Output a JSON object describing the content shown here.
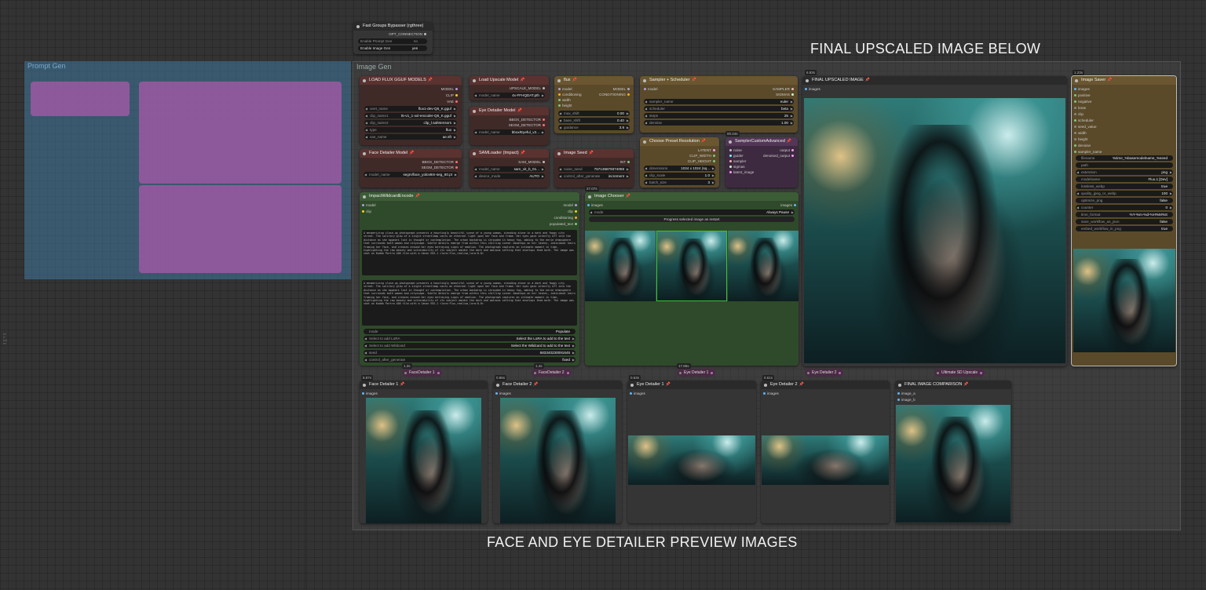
{
  "colors": {
    "canvas": "#333333",
    "group_blue": "#3f789e",
    "group_purple": "#a050a0",
    "node_dark": "#353535",
    "node_brown": "#3f2a28",
    "node_gold": "#5a4a2a",
    "node_green": "#2f4a2a",
    "node_purple": "#3e2a40"
  },
  "annotations": {
    "top_label": "FINAL UPSCALED IMAGE BELOW",
    "bottom_label": "FACE AND EYE DETAILER PREVIEW IMAGES"
  },
  "bypasser": {
    "title": "Fast Groups Bypasser (rgthree)",
    "output": "OPT_CONNECTION",
    "rows": [
      {
        "label": "Enable Prompt Gen",
        "state": "no"
      },
      {
        "label": "Enable Image Gen",
        "state": "yes"
      }
    ]
  },
  "groups": {
    "image_gen": "Image Gen",
    "prompt_gen": "Prompt Gen"
  },
  "flux_models": {
    "title": "LOAD FLUX GGUF MODELS",
    "outputs": [
      "MODEL",
      "CLIP",
      "VAE"
    ],
    "widgets": [
      {
        "label": "unet_name",
        "value": "flux1-dev-Q6_K.gguf"
      },
      {
        "label": "clip_name1",
        "value": "t5-v1_1-xxl-encoder-Q6_K.gguf"
      },
      {
        "label": "clip_name2",
        "value": "clip_l.safetensors"
      },
      {
        "label": "type",
        "value": "flux"
      },
      {
        "label": "vae_name",
        "value": "ae.sft"
      }
    ]
  },
  "upscale_model": {
    "title": "Load Upscale Model",
    "output": "UPSCALE_MODEL",
    "widget": {
      "label": "model_name",
      "value": "4x-FFHQDAT.pth"
    }
  },
  "eye_detailer_model": {
    "title": "Eye Detailer Model",
    "outputs": [
      "BBOX_DETECTOR",
      "SEGM_DETECTOR"
    ],
    "widget": {
      "label": "model_name",
      "value": "bbox/Eyeful_v2..."
    }
  },
  "flux_node": {
    "title": "flux",
    "inputs": [
      "model",
      "conditioning",
      "width",
      "height"
    ],
    "outputs": [
      "MODEL",
      "CONDITIONING"
    ],
    "widgets": [
      {
        "label": "max_shift",
        "value": "0.00"
      },
      {
        "label": "base_shift",
        "value": "0.40"
      },
      {
        "label": "guidance",
        "value": "3.8"
      }
    ]
  },
  "sampler": {
    "title": "Sampler + Scheduler",
    "inputs": [
      "model"
    ],
    "outputs": [
      "SAMPLER",
      "SIGMAS"
    ],
    "widgets": [
      {
        "label": "sampler_name",
        "value": "euler"
      },
      {
        "label": "scheduler",
        "value": "beta"
      },
      {
        "label": "steps",
        "value": "25"
      },
      {
        "label": "denoise",
        "value": "1.00"
      }
    ]
  },
  "face_detailer_model": {
    "title": "Face Detailer Model",
    "outputs": [
      "BBOX_DETECTOR",
      "SEGM_DETECTOR"
    ],
    "widget": {
      "label": "model_name",
      "value": "segm/face_yolov8m-seg_60.pt"
    }
  },
  "sam_loader": {
    "title": "SAMLoader (Impact)",
    "output": "SAM_MODEL",
    "widgets": [
      {
        "label": "model_name",
        "value": "sam_vit_b_01..."
      },
      {
        "label": "device_mode",
        "value": "AUTO"
      }
    ]
  },
  "image_seed": {
    "title": "Image Seed",
    "output": "INT",
    "widgets": [
      {
        "label": "noise_seed",
        "value": "757135879374059"
      },
      {
        "label": "control_after_generate",
        "value": "increment"
      }
    ]
  },
  "preset_res": {
    "title": "Choose Preset Resolution",
    "badge": "00.24s",
    "outputs": [
      "LATENT",
      "CLIP_WIDTH",
      "CLIP_HEIGHT"
    ],
    "widgets": [
      {
        "label": "dimensions",
        "value": "1024 x 1024 (sq..."
      },
      {
        "label": "clip_scale",
        "value": "1.0"
      },
      {
        "label": "batch_size",
        "value": "3"
      }
    ]
  },
  "sampler_custom": {
    "title": "SamplerCustomAdvanced",
    "inputs": [
      "noise",
      "guider",
      "sampler",
      "sigmas",
      "latent_image"
    ],
    "outputs": [
      "output",
      "denoised_output"
    ]
  },
  "wildcard": {
    "title": "ImpactWildcardEncode",
    "inputs": [
      "model",
      "clip"
    ],
    "outputs": [
      "model",
      "clip",
      "conditioning",
      "populated_text"
    ],
    "prompt_text": "A mesmerizing close-up photograph presents a hauntingly beautiful scene of a young woman, standing alone in a dark and foggy city street. The solitary glow of a single streetlamp casts an ethereal light upon her face and frame. Her eyes gaze intently off into the distance as she appears lost in thought or contemplation. The urban backdrop is shrouded in heavy fog, adding to the eerie atmosphere that surrounds both woman and cityscape. Subtle details emerge from within this chilling scene: dewdrops on her lashes, individual hairs framing her face, and creases around her eyes betraying signs of emotion. The photograph captures an intimate moment in time, highlighting the raw beauty and vulnerability of its subject amidst the dark and ominous setting that envelops them both. The image was shot on Kodak Portra 400 film with a Canon EOS-1 <lora:flux_realism_lora:0.8>",
    "widgets": [
      {
        "label": "mode",
        "value": "Populate"
      },
      {
        "label": "Select to add LoRA",
        "value": "Select the LoRA to add to the text"
      },
      {
        "label": "Select to add Wildcard",
        "value": "Select the Wildcard to add to the text"
      },
      {
        "label": "seed",
        "value": "683340230091645"
      },
      {
        "label": "control_after_generate",
        "value": "fixed"
      }
    ]
  },
  "image_chooser": {
    "title": "Image Chooser",
    "badge": "27.07s",
    "input": "images",
    "output": "images",
    "mode_label": "mode",
    "mode_value": "Always Pause",
    "button": "Progress selected image as restart"
  },
  "final_upscaled": {
    "title": "FINAL UPSCALED IMAGE",
    "badge": "6.93s",
    "input": "images"
  },
  "image_saver": {
    "title": "Image Saver",
    "badge": "1.23s",
    "inputs": [
      "images",
      "positive",
      "negative",
      "loras",
      "clip",
      "scheduler",
      "seed_value",
      "width",
      "height",
      "denoise",
      "sampler_name"
    ],
    "widgets": [
      {
        "label": "filename",
        "value": "%time_%basemodelname_%seed"
      },
      {
        "label": "path",
        "value": ""
      },
      {
        "label": "extension",
        "value": "png"
      },
      {
        "label": "modelname",
        "value": "Flux.1 [Dev]"
      },
      {
        "label": "lossless_webp",
        "value": "true"
      },
      {
        "label": "quality_jpeg_or_webp",
        "value": "100"
      },
      {
        "label": "optimize_png",
        "value": "false"
      },
      {
        "label": "counter",
        "value": "0"
      },
      {
        "label": "time_format",
        "value": "%Y-%m-%d-%H%M%S"
      },
      {
        "label": "save_workflow_as_json",
        "value": "false"
      },
      {
        "label": "embed_workflow_in_png",
        "value": "true"
      }
    ]
  },
  "reroutes": [
    {
      "label": "FaceDetailer 1"
    },
    {
      "label": "FaceDetailer 2"
    },
    {
      "label": "Eye Detailer 1"
    },
    {
      "label": "Eye Detailer 2"
    },
    {
      "label": "Ultimate SD Upscale"
    }
  ],
  "reroute_badges": [
    "1.3s",
    "1.4s",
    "17.86s"
  ],
  "previews": [
    {
      "title": "Face Detailer 1",
      "badge": "8.87s",
      "input": "images"
    },
    {
      "title": "Face Detailer 2",
      "badge": "0.86s",
      "input": "images"
    },
    {
      "title": "Eye Detailer 1",
      "badge": "0.63s",
      "input": "images"
    },
    {
      "title": "Eye Detailer 2",
      "badge": "0.61s",
      "input": "images"
    }
  ],
  "comparison": {
    "title": "FINAL IMAGE COMPARISON",
    "inputs": [
      "image_a",
      "image_b"
    ]
  }
}
